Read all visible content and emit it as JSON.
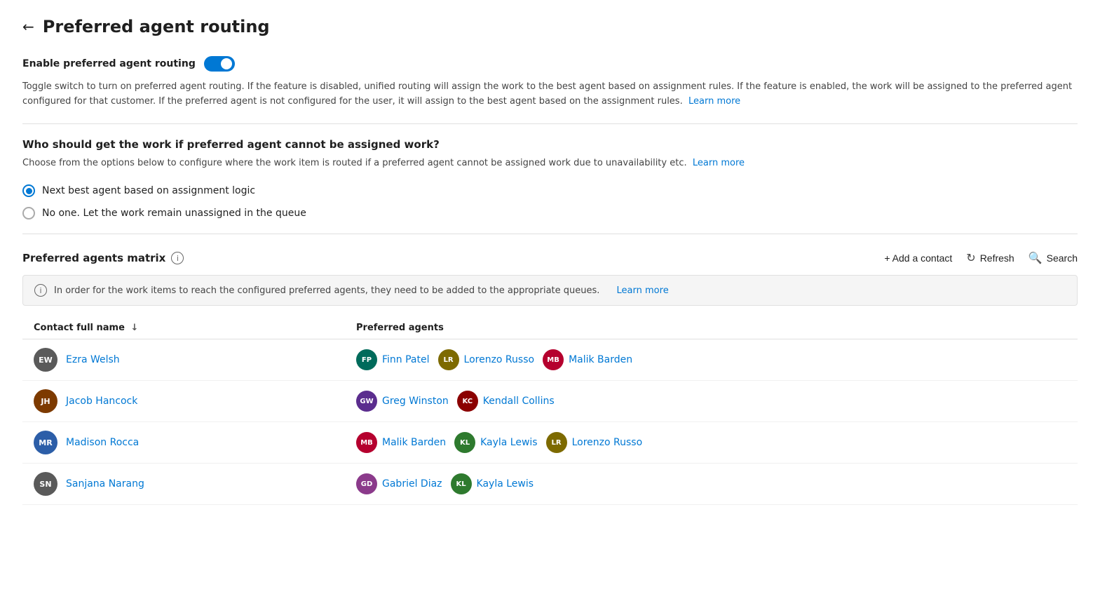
{
  "page": {
    "back_label": "←",
    "title": "Preferred agent routing"
  },
  "enable_section": {
    "label": "Enable preferred agent routing",
    "toggle_on": true,
    "description": "Toggle switch to turn on preferred agent routing. If the feature is disabled, unified routing will assign the work to the best agent based on assignment rules. If the feature is enabled, the work will be assigned to the preferred agent configured for that customer. If the preferred agent is not configured for the user, it will assign to the best agent based on the assignment rules.",
    "learn_more": "Learn more"
  },
  "fallback_section": {
    "title": "Who should get the work if preferred agent cannot be assigned work?",
    "description": "Choose from the options below to configure where the work item is routed if a preferred agent cannot be assigned work due to unavailability etc.",
    "learn_more": "Learn more",
    "options": [
      {
        "id": "next-best",
        "label": "Next best agent based on assignment logic",
        "selected": true
      },
      {
        "id": "no-one",
        "label": "No one. Let the work remain unassigned in the queue",
        "selected": false
      }
    ]
  },
  "matrix_section": {
    "title": "Preferred agents matrix",
    "info_icon": "i",
    "actions": {
      "add_label": "+ Add a contact",
      "refresh_label": "Refresh",
      "search_label": "Search"
    },
    "banner": {
      "icon": "i",
      "text": "In order for the work items to reach the configured preferred agents, they need to be added to the appropriate queues.",
      "learn_more": "Learn more"
    },
    "columns": [
      {
        "label": "Contact full name",
        "sortable": true
      },
      {
        "label": "Preferred agents",
        "sortable": false
      }
    ],
    "rows": [
      {
        "contact": {
          "initials": "EW",
          "name": "Ezra Welsh",
          "bg": "#5a5a5a"
        },
        "agents": [
          {
            "initials": "FP",
            "name": "Finn Patel",
            "bg": "#006b5b"
          },
          {
            "initials": "LR",
            "name": "Lorenzo Russo",
            "bg": "#7d6a00"
          },
          {
            "initials": "MB",
            "name": "Malik Barden",
            "bg": "#b5002e"
          }
        ]
      },
      {
        "contact": {
          "initials": "JH",
          "name": "Jacob Hancock",
          "bg": "#7d3a00"
        },
        "agents": [
          {
            "initials": "GW",
            "name": "Greg Winston",
            "bg": "#5b2d8e"
          },
          {
            "initials": "KC",
            "name": "Kendall Collins",
            "bg": "#8b0000"
          }
        ]
      },
      {
        "contact": {
          "initials": "MR",
          "name": "Madison Rocca",
          "bg": "#2c5ea8"
        },
        "agents": [
          {
            "initials": "MB",
            "name": "Malik Barden",
            "bg": "#b5002e"
          },
          {
            "initials": "KL",
            "name": "Kayla Lewis",
            "bg": "#2e7a2e"
          },
          {
            "initials": "LR",
            "name": "Lorenzo Russo",
            "bg": "#7d6a00"
          }
        ]
      },
      {
        "contact": {
          "initials": "SN",
          "name": "Sanjana Narang",
          "bg": "#5a5a5a"
        },
        "agents": [
          {
            "initials": "GD",
            "name": "Gabriel Diaz",
            "bg": "#8b3a8b"
          },
          {
            "initials": "KL",
            "name": "Kayla Lewis",
            "bg": "#2e7a2e"
          }
        ]
      }
    ]
  }
}
